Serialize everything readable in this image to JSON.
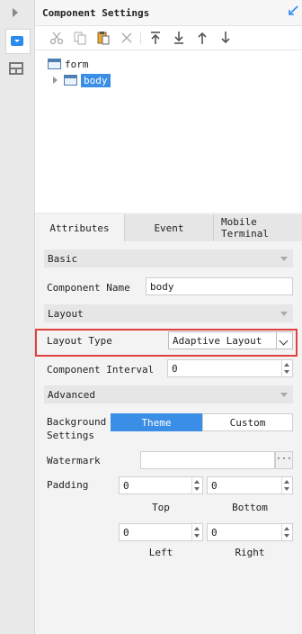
{
  "panel": {
    "title": "Component Settings"
  },
  "toolbar": {
    "icons": [
      "cut-icon",
      "copy-icon",
      "paste-icon",
      "delete-icon",
      "move-top-icon",
      "move-bottom-icon",
      "move-up-icon",
      "move-down-icon"
    ]
  },
  "tree": {
    "root": {
      "label": "form"
    },
    "child": {
      "label": "body"
    }
  },
  "tabs": {
    "attributes": "Attributes",
    "event": "Event",
    "mobile_line1": "Mobile",
    "mobile_line2": "Terminal"
  },
  "sections": {
    "basic": "Basic",
    "layout": "Layout",
    "advanced": "Advanced"
  },
  "fields": {
    "component_name": {
      "label": "Component Name",
      "value": "body"
    },
    "layout_type": {
      "label": "Layout Type",
      "value": "Adaptive Layout"
    },
    "component_interval": {
      "label": "Component Interval",
      "value": "0"
    },
    "background": {
      "label_line1": "Background",
      "label_line2": "Settings",
      "option_theme": "Theme",
      "option_custom": "Custom"
    },
    "watermark": {
      "label": "Watermark",
      "value": "",
      "button": "···"
    },
    "padding": {
      "label": "Padding",
      "top": "0",
      "bottom": "0",
      "left": "0",
      "right": "0",
      "top_caption": "Top",
      "bottom_caption": "Bottom",
      "left_caption": "Left",
      "right_caption": "Right"
    }
  },
  "colors": {
    "accent": "#3a8ee6",
    "highlight": "#e04040"
  }
}
